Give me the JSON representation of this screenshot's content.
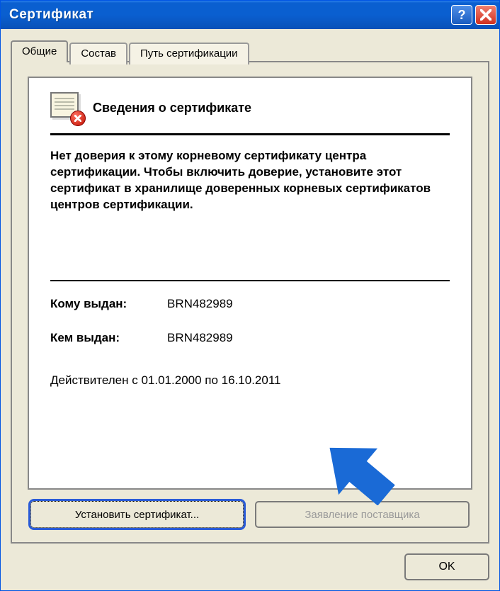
{
  "window": {
    "title": "Сертификат"
  },
  "tabs": {
    "general": "Общие",
    "details": "Состав",
    "path": "Путь сертификации"
  },
  "cert": {
    "heading": "Сведения о сертификате",
    "message": "Нет доверия к этому корневому сертификату центра сертификации. Чтобы включить  доверие, установите этот сертификат в хранилище доверенных корневых сертификатов центров сертификации.",
    "issued_to_label": "Кому выдан:",
    "issued_to_value": "BRN482989",
    "issued_by_label": "Кем выдан:",
    "issued_by_value": "BRN482989",
    "validity": "Действителен с 01.01.2000 по 16.10.2011"
  },
  "buttons": {
    "install": "Установить сертификат...",
    "issuer_statement": "Заявление поставщика",
    "ok": "OK"
  },
  "icons": {
    "help": "?",
    "close": "close-icon",
    "cert_error": "cert-error-icon",
    "arrow": "arrow-icon"
  }
}
